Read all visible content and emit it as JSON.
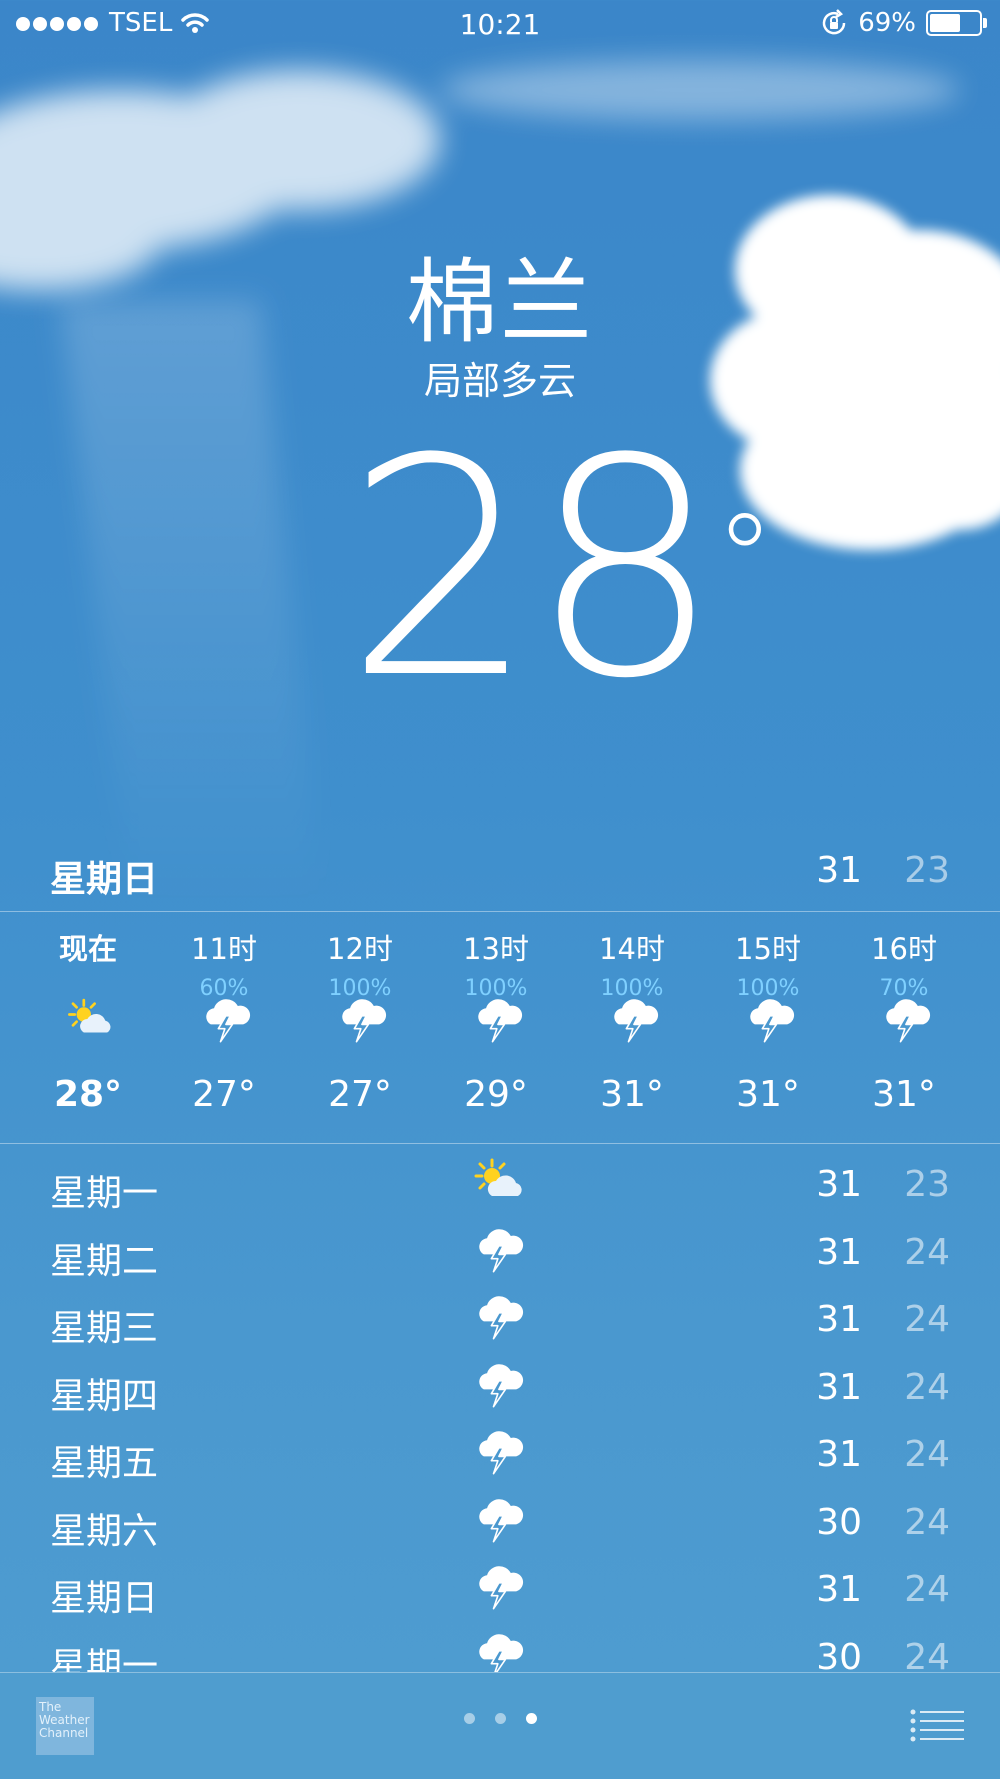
{
  "status_bar": {
    "carrier": "TSEL",
    "time": "10:21",
    "battery_percent": "69%",
    "battery_level": 0.69
  },
  "location": {
    "city": "棉兰",
    "condition": "局部多云",
    "temperature": "28",
    "degree_symbol": "°"
  },
  "today": {
    "day": "星期日",
    "high": "31",
    "low": "23"
  },
  "hourly": [
    {
      "time": "现在",
      "precip": "",
      "icon": "partly-cloudy-icon",
      "temp": "28°"
    },
    {
      "time": "11时",
      "precip": "60%",
      "icon": "thunderstorm-icon",
      "temp": "27°"
    },
    {
      "time": "12时",
      "precip": "100%",
      "icon": "thunderstorm-icon",
      "temp": "27°"
    },
    {
      "time": "13时",
      "precip": "100%",
      "icon": "thunderstorm-icon",
      "temp": "29°"
    },
    {
      "time": "14时",
      "precip": "100%",
      "icon": "thunderstorm-icon",
      "temp": "31°"
    },
    {
      "time": "15时",
      "precip": "100%",
      "icon": "thunderstorm-icon",
      "temp": "31°"
    },
    {
      "time": "16时",
      "precip": "70%",
      "icon": "thunderstorm-icon",
      "temp": "31°"
    }
  ],
  "daily": [
    {
      "day": "星期一",
      "icon": "partly-cloudy-icon",
      "high": "31",
      "low": "23"
    },
    {
      "day": "星期二",
      "icon": "thunderstorm-icon",
      "high": "31",
      "low": "24"
    },
    {
      "day": "星期三",
      "icon": "thunderstorm-icon",
      "high": "31",
      "low": "24"
    },
    {
      "day": "星期四",
      "icon": "thunderstorm-icon",
      "high": "31",
      "low": "24"
    },
    {
      "day": "星期五",
      "icon": "thunderstorm-icon",
      "high": "31",
      "low": "24"
    },
    {
      "day": "星期六",
      "icon": "thunderstorm-icon",
      "high": "30",
      "low": "24"
    },
    {
      "day": "星期日",
      "icon": "thunderstorm-icon",
      "high": "31",
      "low": "24"
    },
    {
      "day": "星期一",
      "icon": "thunderstorm-icon",
      "high": "30",
      "low": "24"
    }
  ],
  "footer": {
    "logo_text": "The Weather Channel",
    "page_count": 3,
    "active_page": 3
  },
  "colors": {
    "precip": "#7fd0ff",
    "sky": "#3f8fcd",
    "sun": "#ffd21f"
  }
}
